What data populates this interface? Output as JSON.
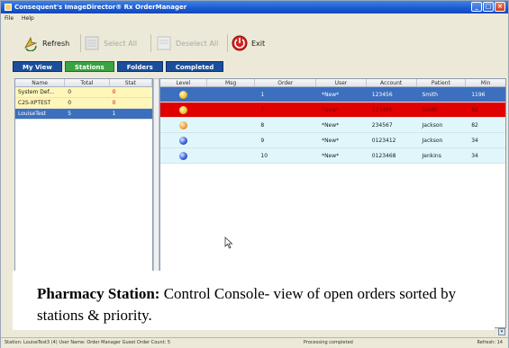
{
  "window": {
    "title": "Consequent's ImageDirector® Rx OrderManager",
    "minimize_glyph": "_",
    "maximize_glyph": "□",
    "close_glyph": "×"
  },
  "menu": {
    "items": [
      "File",
      "Help"
    ]
  },
  "toolbar": {
    "refresh": "Refresh",
    "select_all": "Select All",
    "deselect_all": "Deselect All",
    "exit": "Exit"
  },
  "tabs": [
    "My View",
    "Stations",
    "Folders",
    "Completed"
  ],
  "left_grid": {
    "columns": [
      "Name",
      "Total",
      "Stat"
    ],
    "rows": [
      {
        "name": "System Def...",
        "total": "0",
        "stat": "0",
        "state": "yellow"
      },
      {
        "name": "C2S-XPTEST",
        "total": "0",
        "stat": "0",
        "state": "yellow"
      },
      {
        "name": "LouiseTest",
        "total": "5",
        "stat": "1",
        "state": "selected"
      }
    ]
  },
  "right_grid": {
    "columns": [
      "Level",
      "Msg",
      "Order",
      "User",
      "Account",
      "Patient",
      "Min"
    ],
    "rows": [
      {
        "level": "yellow",
        "msg": "",
        "order": "1",
        "user": "*New*",
        "account": "123456",
        "patient": "Smith",
        "min": "1196",
        "state": "selected"
      },
      {
        "level": "yellow",
        "msg": "",
        "order": "7",
        "user": "*New*",
        "account": "123456",
        "patient": "Smith",
        "min": "82",
        "state": "stat"
      },
      {
        "level": "orange",
        "msg": "",
        "order": "8",
        "user": "*New*",
        "account": "234567",
        "patient": "Jackson",
        "min": "82",
        "state": "normal"
      },
      {
        "level": "blue",
        "msg": "",
        "order": "9",
        "user": "*New*",
        "account": "0123412",
        "patient": "Jackson",
        "min": "34",
        "state": "normal"
      },
      {
        "level": "blue",
        "msg": "",
        "order": "10",
        "user": "*New*",
        "account": "0123468",
        "patient": "Jenkins",
        "min": "34",
        "state": "normal"
      }
    ]
  },
  "caption": {
    "label": "Pharmacy Station:",
    "text": " Control Console- view of open orders sorted by stations & priority."
  },
  "status": {
    "left": "Station: LouiseTest3 (4)  User Name: Order Manager Guest  Order Count: 5",
    "middle": "Processing completed",
    "right": "Refresh: 14"
  },
  "colors": {
    "stations_tab": "#3aa342",
    "stat_row": "#e10000",
    "selected_row": "#3c6fbe",
    "yellow_row": "#fff6b9",
    "cyan_row": "#dff7fb"
  }
}
